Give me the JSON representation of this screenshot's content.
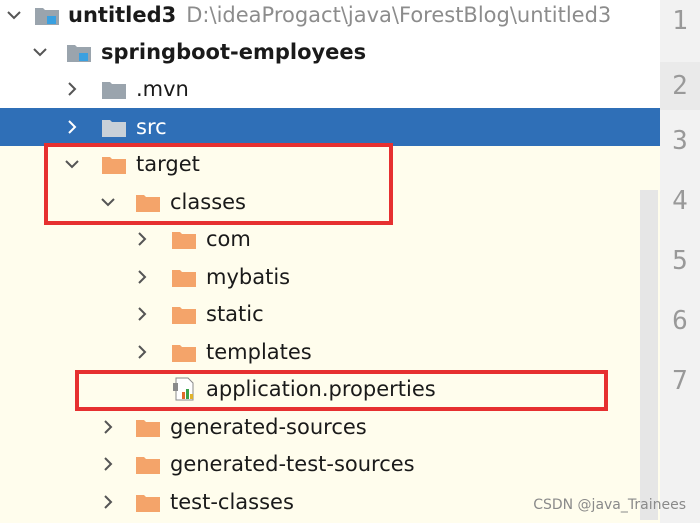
{
  "project_tree": {
    "root": {
      "label": "untitled3",
      "path": "D:\\ideaProgact\\java\\ForestBlog\\untitled3",
      "icon": "project-folder-icon"
    },
    "module": {
      "label": "springboot-employees",
      "icon": "module-folder-icon"
    },
    "items": [
      {
        "label": ".mvn",
        "icon": "folder-icon",
        "arrow": "chevron-right-icon"
      },
      {
        "label": "src",
        "icon": "folder-icon",
        "arrow": "chevron-right-icon",
        "selected": true
      },
      {
        "label": "target",
        "icon": "excluded-folder-icon",
        "arrow": "chevron-down-icon"
      },
      {
        "label": "classes",
        "icon": "excluded-folder-icon",
        "arrow": "chevron-down-icon"
      },
      {
        "label": "com",
        "icon": "excluded-folder-icon",
        "arrow": "chevron-right-icon"
      },
      {
        "label": "mybatis",
        "icon": "excluded-folder-icon",
        "arrow": "chevron-right-icon"
      },
      {
        "label": "static",
        "icon": "excluded-folder-icon",
        "arrow": "chevron-right-icon"
      },
      {
        "label": "templates",
        "icon": "excluded-folder-icon",
        "arrow": "chevron-right-icon"
      },
      {
        "label": "application.properties",
        "icon": "properties-file-icon"
      },
      {
        "label": "generated-sources",
        "icon": "excluded-folder-icon",
        "arrow": "chevron-right-icon"
      },
      {
        "label": "generated-test-sources",
        "icon": "excluded-folder-icon",
        "arrow": "chevron-right-icon"
      },
      {
        "label": "test-classes",
        "icon": "excluded-folder-icon",
        "arrow": "chevron-right-icon"
      }
    ]
  },
  "editor_gutter": {
    "line_numbers": [
      "1",
      "2",
      "3",
      "4",
      "5",
      "6",
      "7"
    ]
  },
  "watermark": "CSDN @java_Trainees",
  "colors": {
    "selection": "#2f6fb7",
    "excluded_background": "#fffded",
    "excluded_folder": "#f4a46a",
    "folder": "#9aa4ad",
    "highlight_box": "#e63030"
  }
}
